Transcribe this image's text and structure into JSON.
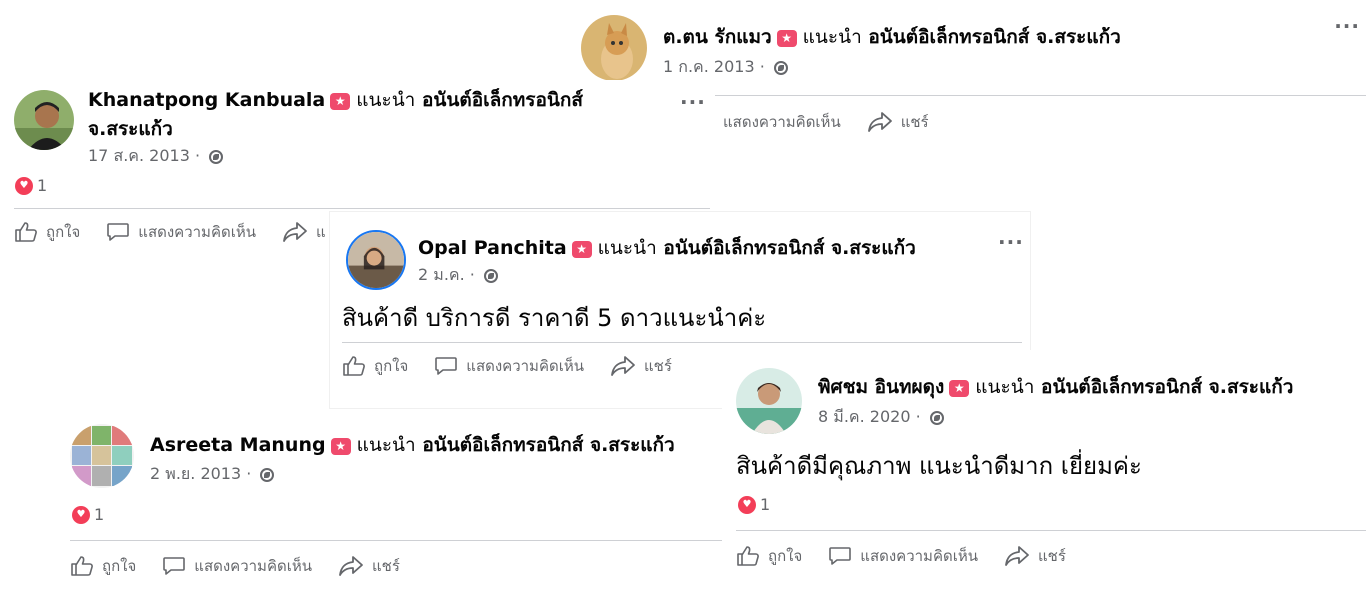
{
  "common": {
    "badge_text": "แนะนำ",
    "page_name": "อนันต์อิเล็กทรอนิกส์ จ.สระแก้ว",
    "like_label": "ถูกใจ",
    "comment_label": "แสดงความคิดเห็น",
    "share_label": "แชร์",
    "more_label": "···",
    "separator": "·"
  },
  "posts": [
    {
      "author": "ต.ตน รักแมว",
      "date": "1 ก.ค. 2013",
      "text": "",
      "reactions": ""
    },
    {
      "author": "Khanatpong Kanbuala",
      "date": "17 ส.ค. 2013",
      "text": "",
      "reactions": "1",
      "page_line1": "อนันต์อิเล็กทรอนิกส์",
      "page_line2": "จ.สระแก้ว",
      "share_partial": "แ"
    },
    {
      "author": "Opal Panchita",
      "date": "2 ม.ค.",
      "text": "สินค้าดี บริการดี ราคาดี 5 ดาวแนะนำค่ะ",
      "reactions": ""
    },
    {
      "author": "Asreeta Manung",
      "date": "2 พ.ย. 2013",
      "text": "",
      "reactions": "1"
    },
    {
      "author": "พิศชม อินทผดุง",
      "date": "8 มี.ค. 2020",
      "text": "สินค้าดีมีคุณภาพ แนะนำดีมาก เยี่ยมค่ะ",
      "reactions": "1"
    }
  ],
  "icons": [
    "thumbs-up-icon",
    "comment-icon",
    "share-icon",
    "heart-icon",
    "globe-icon",
    "recommend-star-icon",
    "more-icon"
  ],
  "colors": {
    "recommend_badge": "#ef4a6c",
    "heart": "#f33e58",
    "meta_gray": "#65676b"
  }
}
